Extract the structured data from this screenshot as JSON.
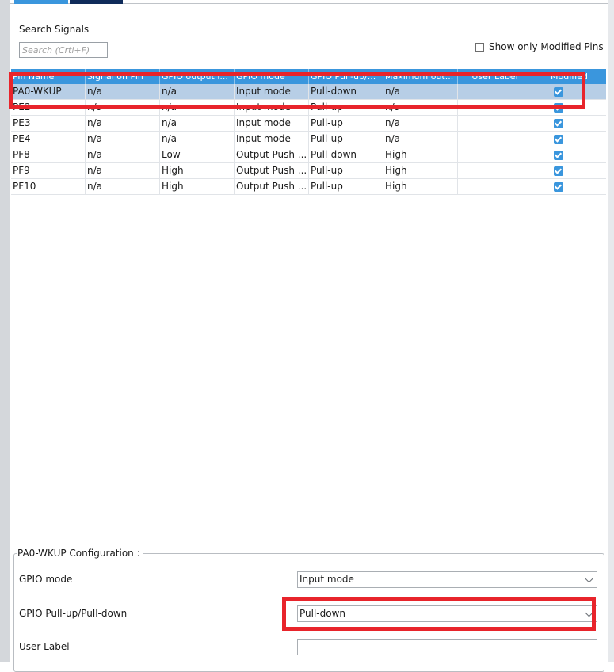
{
  "search": {
    "title": "Search Signals",
    "placeholder": "Search (Crtl+F)"
  },
  "filter": {
    "show_modified_label": "Show only Modified Pins"
  },
  "table": {
    "headers": [
      "Pin Name",
      "Signal on Pin",
      "GPIO output l...",
      "GPIO mode",
      "GPIO Pull-up/...",
      "Maximum out...",
      "User Label",
      "Modified"
    ],
    "rows": [
      {
        "pin": "PA0-WKUP",
        "signal": "n/a",
        "output": "n/a",
        "mode": "Input mode",
        "pull": "Pull-down",
        "speed": "n/a",
        "label": "",
        "modified": true
      },
      {
        "pin": "PE2",
        "signal": "n/a",
        "output": "n/a",
        "mode": "Input mode",
        "pull": "Pull-up",
        "speed": "n/a",
        "label": "",
        "modified": true
      },
      {
        "pin": "PE3",
        "signal": "n/a",
        "output": "n/a",
        "mode": "Input mode",
        "pull": "Pull-up",
        "speed": "n/a",
        "label": "",
        "modified": true
      },
      {
        "pin": "PE4",
        "signal": "n/a",
        "output": "n/a",
        "mode": "Input mode",
        "pull": "Pull-up",
        "speed": "n/a",
        "label": "",
        "modified": true
      },
      {
        "pin": "PF8",
        "signal": "n/a",
        "output": "Low",
        "mode": "Output Push ...",
        "pull": "Pull-down",
        "speed": "High",
        "label": "",
        "modified": true
      },
      {
        "pin": "PF9",
        "signal": "n/a",
        "output": "High",
        "mode": "Output Push ...",
        "pull": "Pull-up",
        "speed": "High",
        "label": "",
        "modified": true
      },
      {
        "pin": "PF10",
        "signal": "n/a",
        "output": "High",
        "mode": "Output Push ...",
        "pull": "Pull-up",
        "speed": "High",
        "label": "",
        "modified": true
      }
    ]
  },
  "config": {
    "title": "PA0-WKUP Configuration :",
    "gpio_mode_label": "GPIO mode",
    "gpio_mode_value": "Input mode",
    "pull_label": "GPIO Pull-up/Pull-down",
    "pull_value": "Pull-down",
    "user_label_label": "User Label",
    "user_label_value": ""
  },
  "colors": {
    "header_bg": "#3a96dd",
    "selected_row": "#b7cee6",
    "highlight_box": "#e8242b",
    "tab_active": "#0f2b5a"
  },
  "icons": {
    "modified_checkbox": "checkmark-icon",
    "dropdown": "chevron-down-icon"
  }
}
